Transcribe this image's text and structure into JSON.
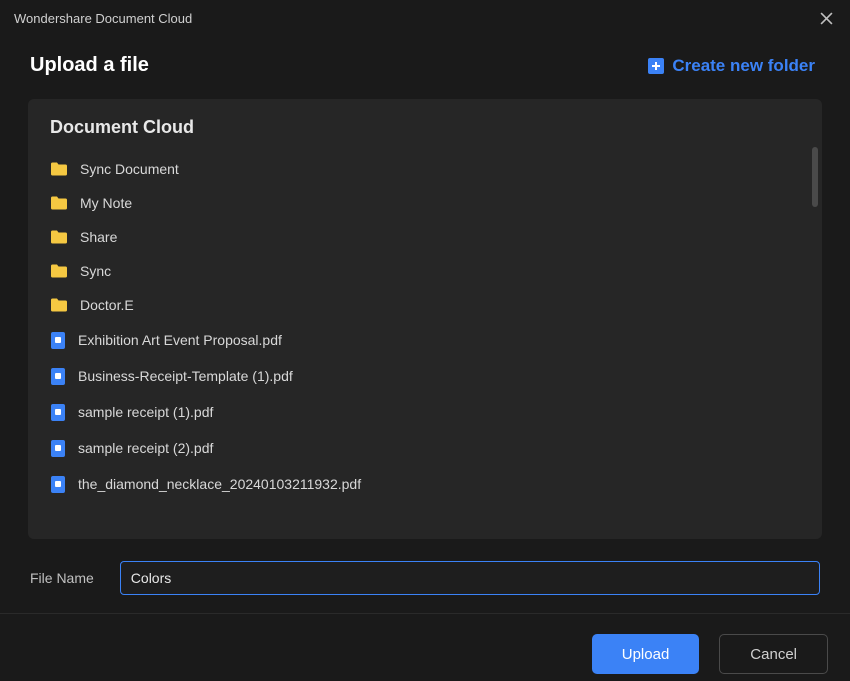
{
  "window": {
    "title": "Wondershare Document Cloud"
  },
  "header": {
    "title": "Upload a file",
    "create_folder_label": "Create new folder"
  },
  "panel": {
    "title": "Document Cloud"
  },
  "items": [
    {
      "type": "folder",
      "name": "Sync Document"
    },
    {
      "type": "folder",
      "name": "My Note"
    },
    {
      "type": "folder",
      "name": "Share"
    },
    {
      "type": "folder",
      "name": "Sync"
    },
    {
      "type": "folder",
      "name": "Doctor.E"
    },
    {
      "type": "file",
      "name": "Exhibition Art Event Proposal.pdf"
    },
    {
      "type": "file",
      "name": "Business-Receipt-Template (1).pdf"
    },
    {
      "type": "file",
      "name": "sample receipt (1).pdf"
    },
    {
      "type": "file",
      "name": "sample receipt (2).pdf"
    },
    {
      "type": "file",
      "name": "the_diamond_necklace_20240103211932.pdf"
    }
  ],
  "filename": {
    "label": "File Name",
    "value": "Colors"
  },
  "footer": {
    "upload_label": "Upload",
    "cancel_label": "Cancel"
  }
}
